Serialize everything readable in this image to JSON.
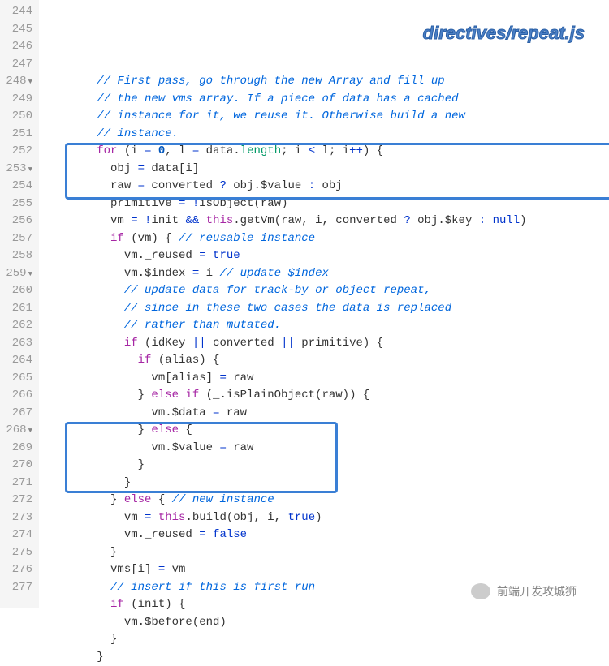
{
  "label": "directives/repeat.js",
  "wx_text": "前端开发攻城狮",
  "lines": [
    {
      "n": "244",
      "fold": false,
      "segs": [
        {
          "t": "        ",
          "c": ""
        },
        {
          "t": "// First pass, go through the new Array and fill up",
          "c": "c-comment"
        }
      ]
    },
    {
      "n": "245",
      "fold": false,
      "segs": [
        {
          "t": "        ",
          "c": ""
        },
        {
          "t": "// the new vms array. If a piece of data has a cached",
          "c": "c-comment"
        }
      ]
    },
    {
      "n": "246",
      "fold": false,
      "segs": [
        {
          "t": "        ",
          "c": ""
        },
        {
          "t": "// instance for it, we reuse it. Otherwise build a new",
          "c": "c-comment"
        }
      ]
    },
    {
      "n": "247",
      "fold": false,
      "segs": [
        {
          "t": "        ",
          "c": ""
        },
        {
          "t": "// instance.",
          "c": "c-comment"
        }
      ]
    },
    {
      "n": "248",
      "fold": true,
      "segs": [
        {
          "t": "        ",
          "c": ""
        },
        {
          "t": "for",
          "c": "c-kw"
        },
        {
          "t": " (i ",
          "c": "c-text"
        },
        {
          "t": "=",
          "c": "c-op"
        },
        {
          "t": " ",
          "c": ""
        },
        {
          "t": "0",
          "c": "c-num"
        },
        {
          "t": ", l ",
          "c": "c-text"
        },
        {
          "t": "=",
          "c": "c-op"
        },
        {
          "t": " data.",
          "c": "c-text"
        },
        {
          "t": "length",
          "c": "c-prop"
        },
        {
          "t": "; i ",
          "c": "c-text"
        },
        {
          "t": "<",
          "c": "c-op"
        },
        {
          "t": " l; i",
          "c": "c-text"
        },
        {
          "t": "++",
          "c": "c-op"
        },
        {
          "t": ") {",
          "c": "c-text"
        }
      ]
    },
    {
      "n": "249",
      "fold": false,
      "segs": [
        {
          "t": "          obj ",
          "c": "c-text"
        },
        {
          "t": "=",
          "c": "c-op"
        },
        {
          "t": " data[i]",
          "c": "c-text"
        }
      ]
    },
    {
      "n": "250",
      "fold": false,
      "segs": [
        {
          "t": "          raw ",
          "c": "c-text"
        },
        {
          "t": "=",
          "c": "c-op"
        },
        {
          "t": " converted ",
          "c": "c-text"
        },
        {
          "t": "?",
          "c": "c-op"
        },
        {
          "t": " obj.$value ",
          "c": "c-text"
        },
        {
          "t": ":",
          "c": "c-op"
        },
        {
          "t": " obj",
          "c": "c-text"
        }
      ]
    },
    {
      "n": "251",
      "fold": false,
      "segs": [
        {
          "t": "          primitive ",
          "c": "c-text"
        },
        {
          "t": "=",
          "c": "c-op"
        },
        {
          "t": " ",
          "c": ""
        },
        {
          "t": "!",
          "c": "c-op"
        },
        {
          "t": "isObject(raw)",
          "c": "c-text"
        }
      ]
    },
    {
      "n": "252",
      "fold": false,
      "segs": [
        {
          "t": "          vm ",
          "c": "c-text"
        },
        {
          "t": "=",
          "c": "c-op"
        },
        {
          "t": " ",
          "c": ""
        },
        {
          "t": "!",
          "c": "c-op"
        },
        {
          "t": "init ",
          "c": "c-text"
        },
        {
          "t": "&&",
          "c": "c-op"
        },
        {
          "t": " ",
          "c": ""
        },
        {
          "t": "this",
          "c": "c-this"
        },
        {
          "t": ".getVm(raw, i, converted ",
          "c": "c-text"
        },
        {
          "t": "?",
          "c": "c-op"
        },
        {
          "t": " obj.$key ",
          "c": "c-text"
        },
        {
          "t": ":",
          "c": "c-op"
        },
        {
          "t": " ",
          "c": ""
        },
        {
          "t": "null",
          "c": "c-const"
        },
        {
          "t": ")",
          "c": "c-text"
        }
      ]
    },
    {
      "n": "253",
      "fold": true,
      "segs": [
        {
          "t": "          ",
          "c": ""
        },
        {
          "t": "if",
          "c": "c-kw"
        },
        {
          "t": " (vm) { ",
          "c": "c-text"
        },
        {
          "t": "// reusable instance",
          "c": "c-comment"
        }
      ]
    },
    {
      "n": "254",
      "fold": false,
      "segs": [
        {
          "t": "            vm._reused ",
          "c": "c-text"
        },
        {
          "t": "=",
          "c": "c-op"
        },
        {
          "t": " ",
          "c": ""
        },
        {
          "t": "true",
          "c": "c-const"
        }
      ]
    },
    {
      "n": "255",
      "fold": false,
      "segs": [
        {
          "t": "            vm.$index ",
          "c": "c-text"
        },
        {
          "t": "=",
          "c": "c-op"
        },
        {
          "t": " i ",
          "c": "c-text"
        },
        {
          "t": "// update $index",
          "c": "c-comment"
        }
      ]
    },
    {
      "n": "256",
      "fold": false,
      "segs": [
        {
          "t": "            ",
          "c": ""
        },
        {
          "t": "// update data for track-by or object repeat,",
          "c": "c-comment"
        }
      ]
    },
    {
      "n": "257",
      "fold": false,
      "segs": [
        {
          "t": "            ",
          "c": ""
        },
        {
          "t": "// since in these two cases the data is replaced",
          "c": "c-comment"
        }
      ]
    },
    {
      "n": "258",
      "fold": false,
      "segs": [
        {
          "t": "            ",
          "c": ""
        },
        {
          "t": "// rather than mutated.",
          "c": "c-comment"
        }
      ]
    },
    {
      "n": "259",
      "fold": true,
      "segs": [
        {
          "t": "            ",
          "c": ""
        },
        {
          "t": "if",
          "c": "c-kw"
        },
        {
          "t": " (idKey ",
          "c": "c-text"
        },
        {
          "t": "||",
          "c": "c-op"
        },
        {
          "t": " converted ",
          "c": "c-text"
        },
        {
          "t": "||",
          "c": "c-op"
        },
        {
          "t": " primitive) {",
          "c": "c-text"
        }
      ]
    },
    {
      "n": "260",
      "fold": false,
      "segs": [
        {
          "t": "              ",
          "c": ""
        },
        {
          "t": "if",
          "c": "c-kw"
        },
        {
          "t": " (alias) {",
          "c": "c-text"
        }
      ]
    },
    {
      "n": "261",
      "fold": false,
      "segs": [
        {
          "t": "                vm[alias] ",
          "c": "c-text"
        },
        {
          "t": "=",
          "c": "c-op"
        },
        {
          "t": " raw",
          "c": "c-text"
        }
      ]
    },
    {
      "n": "262",
      "fold": false,
      "segs": [
        {
          "t": "              } ",
          "c": "c-text"
        },
        {
          "t": "else if",
          "c": "c-kw"
        },
        {
          "t": " (_.isPlainObject(raw)) {",
          "c": "c-text"
        }
      ]
    },
    {
      "n": "263",
      "fold": false,
      "segs": [
        {
          "t": "                vm.$data ",
          "c": "c-text"
        },
        {
          "t": "=",
          "c": "c-op"
        },
        {
          "t": " raw",
          "c": "c-text"
        }
      ]
    },
    {
      "n": "264",
      "fold": false,
      "segs": [
        {
          "t": "              } ",
          "c": "c-text"
        },
        {
          "t": "else",
          "c": "c-kw"
        },
        {
          "t": " {",
          "c": "c-text"
        }
      ]
    },
    {
      "n": "265",
      "fold": false,
      "segs": [
        {
          "t": "                vm.$value ",
          "c": "c-text"
        },
        {
          "t": "=",
          "c": "c-op"
        },
        {
          "t": " raw",
          "c": "c-text"
        }
      ]
    },
    {
      "n": "266",
      "fold": false,
      "segs": [
        {
          "t": "              }",
          "c": "c-text"
        }
      ]
    },
    {
      "n": "267",
      "fold": false,
      "segs": [
        {
          "t": "            }",
          "c": "c-text"
        }
      ]
    },
    {
      "n": "268",
      "fold": true,
      "segs": [
        {
          "t": "          } ",
          "c": "c-text"
        },
        {
          "t": "else",
          "c": "c-kw"
        },
        {
          "t": " { ",
          "c": "c-text"
        },
        {
          "t": "// new instance",
          "c": "c-comment"
        }
      ]
    },
    {
      "n": "269",
      "fold": false,
      "segs": [
        {
          "t": "            vm ",
          "c": "c-text"
        },
        {
          "t": "=",
          "c": "c-op"
        },
        {
          "t": " ",
          "c": ""
        },
        {
          "t": "this",
          "c": "c-this"
        },
        {
          "t": ".build(obj, i, ",
          "c": "c-text"
        },
        {
          "t": "true",
          "c": "c-const"
        },
        {
          "t": ")",
          "c": "c-text"
        }
      ]
    },
    {
      "n": "270",
      "fold": false,
      "segs": [
        {
          "t": "            vm._reused ",
          "c": "c-text"
        },
        {
          "t": "=",
          "c": "c-op"
        },
        {
          "t": " ",
          "c": ""
        },
        {
          "t": "false",
          "c": "c-const"
        }
      ]
    },
    {
      "n": "271",
      "fold": false,
      "segs": [
        {
          "t": "          }",
          "c": "c-text"
        }
      ]
    },
    {
      "n": "272",
      "fold": false,
      "segs": [
        {
          "t": "          vms[i] ",
          "c": "c-text"
        },
        {
          "t": "=",
          "c": "c-op"
        },
        {
          "t": " vm",
          "c": "c-text"
        }
      ]
    },
    {
      "n": "273",
      "fold": false,
      "segs": [
        {
          "t": "          ",
          "c": ""
        },
        {
          "t": "// insert if this is first run",
          "c": "c-comment"
        }
      ]
    },
    {
      "n": "274",
      "fold": false,
      "segs": [
        {
          "t": "          ",
          "c": ""
        },
        {
          "t": "if",
          "c": "c-kw"
        },
        {
          "t": " (init) {",
          "c": "c-text"
        }
      ]
    },
    {
      "n": "275",
      "fold": false,
      "segs": [
        {
          "t": "            vm.$before(end)",
          "c": "c-text"
        }
      ]
    },
    {
      "n": "276",
      "fold": false,
      "segs": [
        {
          "t": "          }",
          "c": "c-text"
        }
      ]
    },
    {
      "n": "277",
      "fold": false,
      "segs": [
        {
          "t": "        }",
          "c": "c-text"
        }
      ]
    }
  ]
}
